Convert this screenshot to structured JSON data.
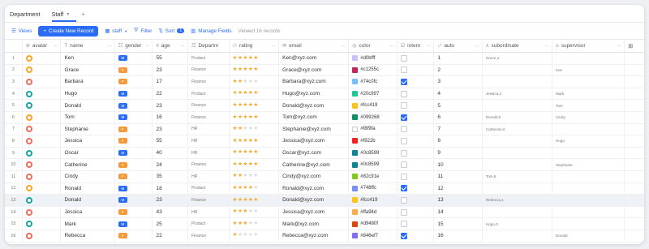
{
  "tabs": [
    {
      "label": "Department"
    },
    {
      "label": "Staff"
    }
  ],
  "toolbar": {
    "views": "Views",
    "create": "Create New Record",
    "table": "staff",
    "filter": "Filter",
    "sort": "Sort",
    "sort_count": "1",
    "manage": "Manage Fields",
    "records": "Viewed 16 records"
  },
  "columns": {
    "avatar": "avatar",
    "name": "name",
    "gender": "gender",
    "age": "age",
    "dept": "Departm",
    "rating": "rating",
    "email": "email",
    "color": "color",
    "intern": "intern",
    "auto": "auto",
    "sub": "subordinate",
    "sup": "supervisor"
  },
  "colors": {
    "primary": "#2b6cf6",
    "female": "#f5993b",
    "male": "#2b6cf6",
    "star_on": "#f5a623",
    "star_off": "#d6d9de"
  },
  "rows": [
    {
      "idx": "1",
      "avatar": "#f5a623",
      "name": "Ken",
      "gender": "M",
      "age": "55",
      "dept": "Product",
      "rating": 5,
      "email": "Ken@xyz.com",
      "color_hex": "#d0bfff",
      "color": "#d0bfff",
      "intern": false,
      "auto": "1",
      "sub": "Grace,4",
      "sup": ""
    },
    {
      "idx": "2",
      "avatar": "#f5a623",
      "name": "Grace",
      "gender": "F",
      "age": "23",
      "dept": "Finance",
      "rating": 5,
      "email": "Grace@xyz.com",
      "color_hex": "#c1255c",
      "color": "#c1255c",
      "intern": false,
      "auto": "2",
      "sub": "",
      "sup": "Ken"
    },
    {
      "idx": "3",
      "avatar": "#ef6b5b",
      "name": "Barbara",
      "gender": "F",
      "age": "17",
      "dept": "Finance",
      "rating": 2,
      "email": "Barbara@xyz.com",
      "color_hex": "#74c0fc",
      "color": "#74c0fc",
      "intern": true,
      "auto": "3",
      "sub": "",
      "sup": ""
    },
    {
      "idx": "4",
      "avatar": "#16a3a3",
      "name": "Hugo",
      "gender": "M",
      "age": "22",
      "dept": "Product",
      "rating": 5,
      "email": "Hugo@xyz.com",
      "color_hex": "#20c997",
      "color": "#20c997",
      "intern": false,
      "auto": "4",
      "sub": "Jessica,2",
      "sup": "Mark"
    },
    {
      "idx": "5",
      "avatar": "#16a3a3",
      "name": "Donald",
      "gender": "M",
      "age": "23",
      "dept": "Finance",
      "rating": 5,
      "email": "Donald@xyz.com",
      "color_hex": "#fcc419",
      "color": "#fcc419",
      "intern": false,
      "auto": "5",
      "sub": "",
      "sup": "Tom"
    },
    {
      "idx": "6",
      "avatar": "#f5a623",
      "name": "Tom",
      "gender": "M",
      "age": "16",
      "dept": "Finance",
      "rating": 5,
      "email": "Tom@xyz.com",
      "color_hex": "#099268",
      "color": "#099268",
      "intern": true,
      "auto": "6",
      "sub": "Donald,5",
      "sup": "Cindy"
    },
    {
      "idx": "7",
      "avatar": "#ef6b5b",
      "name": "Stephanie",
      "gender": "F",
      "age": "23",
      "dept": "HR",
      "rating": 2,
      "email": "Stephanie@xyz.com",
      "color_hex": "#f8f9fa",
      "color": "#f8f9fa",
      "intern": false,
      "auto": "7",
      "sub": "Catherine,0",
      "sup": ""
    },
    {
      "idx": "8",
      "avatar": "#ef6b5b",
      "name": "Jessica",
      "gender": "F",
      "age": "55",
      "dept": "HR",
      "rating": 5,
      "email": "Jessica@xyz.com",
      "color_hex": "#f922b",
      "color": "#f9221e",
      "intern": false,
      "auto": "8",
      "sub": "",
      "sup": "Hugo"
    },
    {
      "idx": "9",
      "avatar": "#16a3a3",
      "name": "Oscar",
      "gender": "M",
      "age": "40",
      "dept": "HR",
      "rating": 5,
      "email": "Oscar@xyz.com",
      "color_hex": "#0c8599",
      "color": "#0c8599",
      "intern": false,
      "auto": "9",
      "sub": "",
      "sup": ""
    },
    {
      "idx": "10",
      "avatar": "#ef6b5b",
      "name": "Catherine",
      "gender": "F",
      "age": "24",
      "dept": "Finance",
      "rating": 5,
      "email": "Catherine@xyz.com",
      "color_hex": "#0c8599",
      "color": "#0c8599",
      "intern": false,
      "auto": "10",
      "sub": "",
      "sup": "Stephanie"
    },
    {
      "idx": "11",
      "avatar": "#ef6b5b",
      "name": "Cindy",
      "gender": "F",
      "age": "35",
      "dept": "HR",
      "rating": 2,
      "email": "Cindy@xyz.com",
      "color_hex": "#82c91e",
      "color": "#82c91e",
      "intern": false,
      "auto": "11",
      "sub": "Tom,6",
      "sup": ""
    },
    {
      "idx": "12",
      "avatar": "#f5a623",
      "name": "Ronald",
      "gender": "M",
      "age": "18",
      "dept": "Product",
      "rating": 4,
      "email": "Ronald@xyz.com",
      "color_hex": "#748ffc",
      "color": "#748ffc",
      "intern": true,
      "auto": "12",
      "sub": "",
      "sup": ""
    },
    {
      "idx": "13",
      "avatar": "#16a3a3",
      "name": "Donald",
      "gender": "M",
      "age": "23",
      "dept": "Finance",
      "rating": 5,
      "email": "Donald@xyz.com",
      "color_hex": "#fcc419",
      "color": "#fcc419",
      "intern": false,
      "auto": "13",
      "sub": "Rebecca,1",
      "sup": ""
    },
    {
      "idx": "14",
      "avatar": "#ef6b5b",
      "name": "Jessica",
      "gender": "F",
      "age": "43",
      "dept": "HR",
      "rating": 3,
      "email": "Jessica@xyz.com",
      "color_hex": "#ffa94d",
      "color": "#ffa94d",
      "intern": false,
      "auto": "14",
      "sub": "",
      "sup": ""
    },
    {
      "idx": "15",
      "avatar": "#16a3a3",
      "name": "Mark",
      "gender": "M",
      "age": "25",
      "dept": "Product",
      "rating": 3,
      "email": "Mark@xyz.com",
      "color_hex": "#d9480f",
      "color": "#d9480f",
      "intern": false,
      "auto": "15",
      "sub": "Hugo,0",
      "sup": ""
    },
    {
      "idx": "16",
      "avatar": "#ef6b5b",
      "name": "Rebecca",
      "gender": "F",
      "age": "22",
      "dept": "Finance",
      "rating": 1,
      "email": "Rebecca@xyz.com",
      "color_hex": "#846ef7",
      "color": "#846ef7",
      "intern": true,
      "auto": "16",
      "sub": "",
      "sup": "Donald"
    }
  ]
}
